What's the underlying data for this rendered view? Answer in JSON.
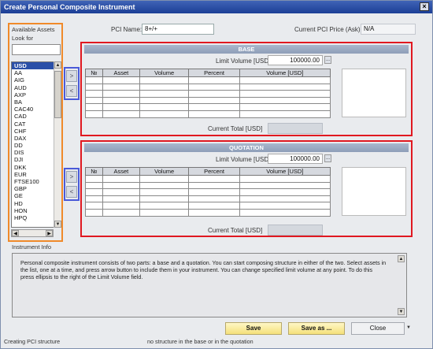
{
  "window": {
    "title": "Create Personal Composite Instrument",
    "close_glyph": "×"
  },
  "assets": {
    "available_label": "Available Assets",
    "look_for_label": "Look for",
    "search_value": "",
    "items": [
      "USD",
      "AA",
      "AIG",
      "AUD",
      "AXP",
      "BA",
      "CAC40",
      "CAD",
      "CAT",
      "CHF",
      "DAX",
      "DD",
      "DIS",
      "DJI",
      "DKK",
      "EUR",
      "FTSE100",
      "GBP",
      "GE",
      "HD",
      "HON",
      "HPQ"
    ],
    "selected": "USD"
  },
  "header": {
    "pci_name_label": "PCI Name:",
    "pci_name_value": "8+/+",
    "price_label": "Current PCI Price (Ask):",
    "price_value": "N/A"
  },
  "move_buttons": {
    "add": ">",
    "remove": "<"
  },
  "columns": [
    "№",
    "Asset",
    "Volume",
    "Percent",
    "Volume [USD]"
  ],
  "base": {
    "title": "BASE",
    "limit_label": "Limit Volume [USD]",
    "limit_value": "100000.00",
    "ellipsis": "...",
    "total_label": "Current Total [USD]",
    "total_value": ""
  },
  "quotation": {
    "title": "QUOTATION",
    "limit_label": "Limit Volume [USD]",
    "limit_value": "100000.00",
    "ellipsis": "...",
    "total_label": "Current Total [USD]",
    "total_value": ""
  },
  "info": {
    "title": "Instrument Info",
    "text": "Personal composite instrument consists of two parts: a base and a quotation. You can start composing structure in either of the two. Select assets in the list, one at a time, and press arrow button to include them in your instrument. You can change specified limit volume at any point. To do this press ellipsis to the right of the Limit Volume field."
  },
  "buttons": {
    "save": "Save",
    "save_as": "Save as ...",
    "close": "Close"
  },
  "status": {
    "left": "Creating PCI structure",
    "right": "no structure in the base or in the quotation"
  },
  "colors": {
    "highlight_orange": "#f08a2a",
    "highlight_red": "#e01820",
    "highlight_blue": "#4a5ad8",
    "selection": "#2a4fa8"
  }
}
